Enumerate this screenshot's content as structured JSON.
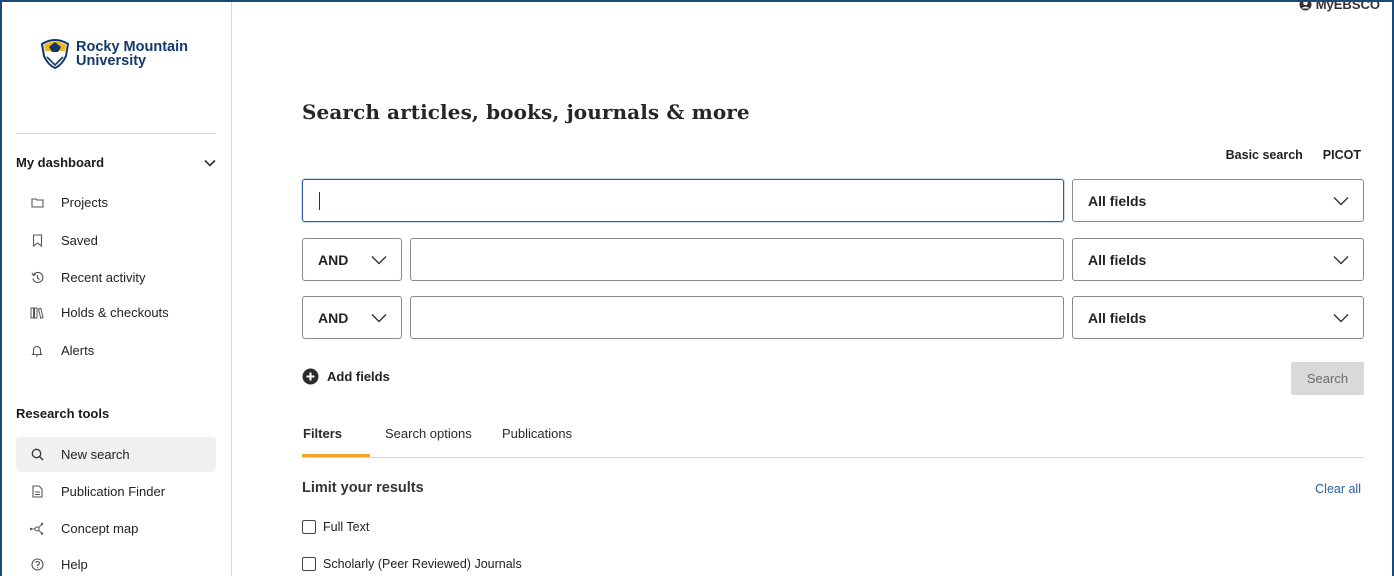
{
  "account": {
    "label": "MyEBSCO",
    "icon": "user-circle-icon"
  },
  "brand": {
    "line1": "Rocky Mountain",
    "line2": "University",
    "color": "#12386b"
  },
  "sidebar": {
    "dashboard_heading": "My dashboard",
    "dashboard_items": [
      {
        "label": "Projects",
        "icon": "folder-icon"
      },
      {
        "label": "Saved",
        "icon": "bookmark-icon"
      },
      {
        "label": "Recent activity",
        "icon": "history-icon"
      },
      {
        "label": "Holds & checkouts",
        "icon": "books-icon"
      },
      {
        "label": "Alerts",
        "icon": "bell-icon"
      }
    ],
    "tools_heading": "Research tools",
    "tools_items": [
      {
        "label": "New search",
        "icon": "search-icon",
        "active": true
      },
      {
        "label": "Publication Finder",
        "icon": "document-icon"
      },
      {
        "label": "Concept map",
        "icon": "network-icon"
      },
      {
        "label": "Help",
        "icon": "help-icon"
      }
    ]
  },
  "main": {
    "title": "Search articles, books, journals & more",
    "modes": {
      "basic": "Basic search",
      "picot": "PICOT"
    },
    "rows": [
      {
        "term": "",
        "field": "All fields"
      },
      {
        "operator": "AND",
        "term": "",
        "field": "All fields"
      },
      {
        "operator": "AND",
        "term": "",
        "field": "All fields"
      }
    ],
    "add_fields": "Add fields",
    "search_button": "Search",
    "tabs": [
      "Filters",
      "Search options",
      "Publications"
    ],
    "limit_title": "Limit your results",
    "clear_all": "Clear all",
    "checkboxes": [
      "Full Text",
      "Scholarly (Peer Reviewed) Journals"
    ]
  },
  "colors": {
    "accent": "#f0a531",
    "link": "#2a5ea6",
    "focus": "#2d5fa5"
  }
}
